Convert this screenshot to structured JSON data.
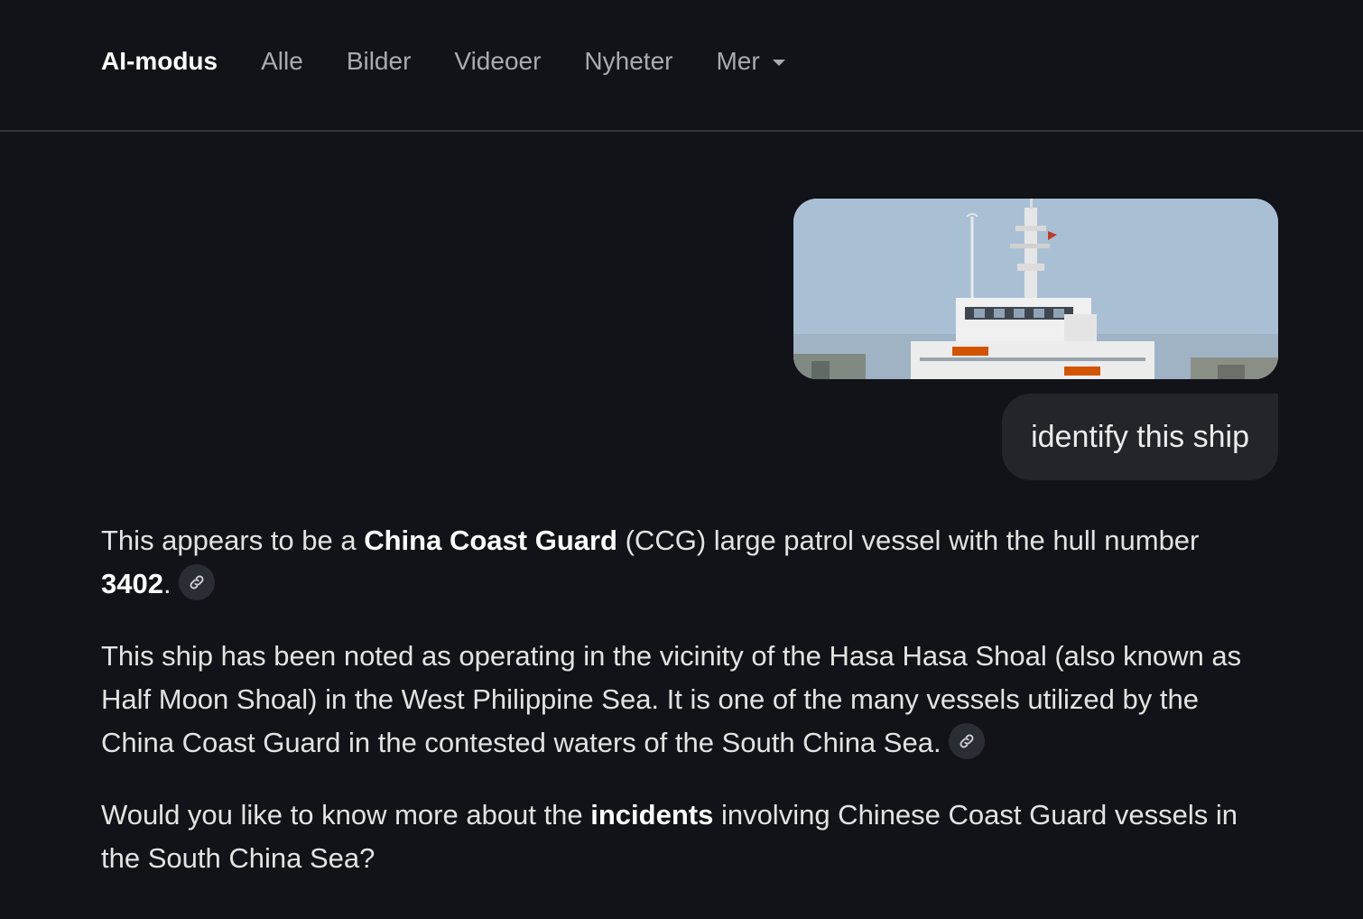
{
  "tabs": [
    {
      "label": "AI-modus",
      "active": true
    },
    {
      "label": "Alle"
    },
    {
      "label": "Bilder"
    },
    {
      "label": "Videoer"
    },
    {
      "label": "Nyheter"
    },
    {
      "label": "Mer"
    }
  ],
  "user_query": "identify this ship",
  "answer": {
    "p1": {
      "t1": "This appears to be a ",
      "b1": "China Coast Guard",
      "t2": " (CCG) large patrol vessel with the hull number ",
      "b2": "3402",
      "t3": "."
    },
    "p2": "This ship has been noted as operating in the vicinity of the Hasa Hasa Shoal (also known as Half Moon Shoal) in the West Philippine Sea. It is one of the many vessels utilized by the China Coast Guard in the contested waters of the South China Sea.",
    "p3": {
      "t1": "Would you like to know more about the ",
      "b1": "incidents",
      "t2": " involving Chinese Coast Guard vessels in the South China Sea?"
    }
  },
  "icons": {
    "tab_more": "chevron-down-icon",
    "source_link": "link-icon"
  },
  "colors": {
    "background": "#111318",
    "bubble": "#23252b",
    "text": "#e3e3e3",
    "muted_tab": "#a8abb0"
  }
}
